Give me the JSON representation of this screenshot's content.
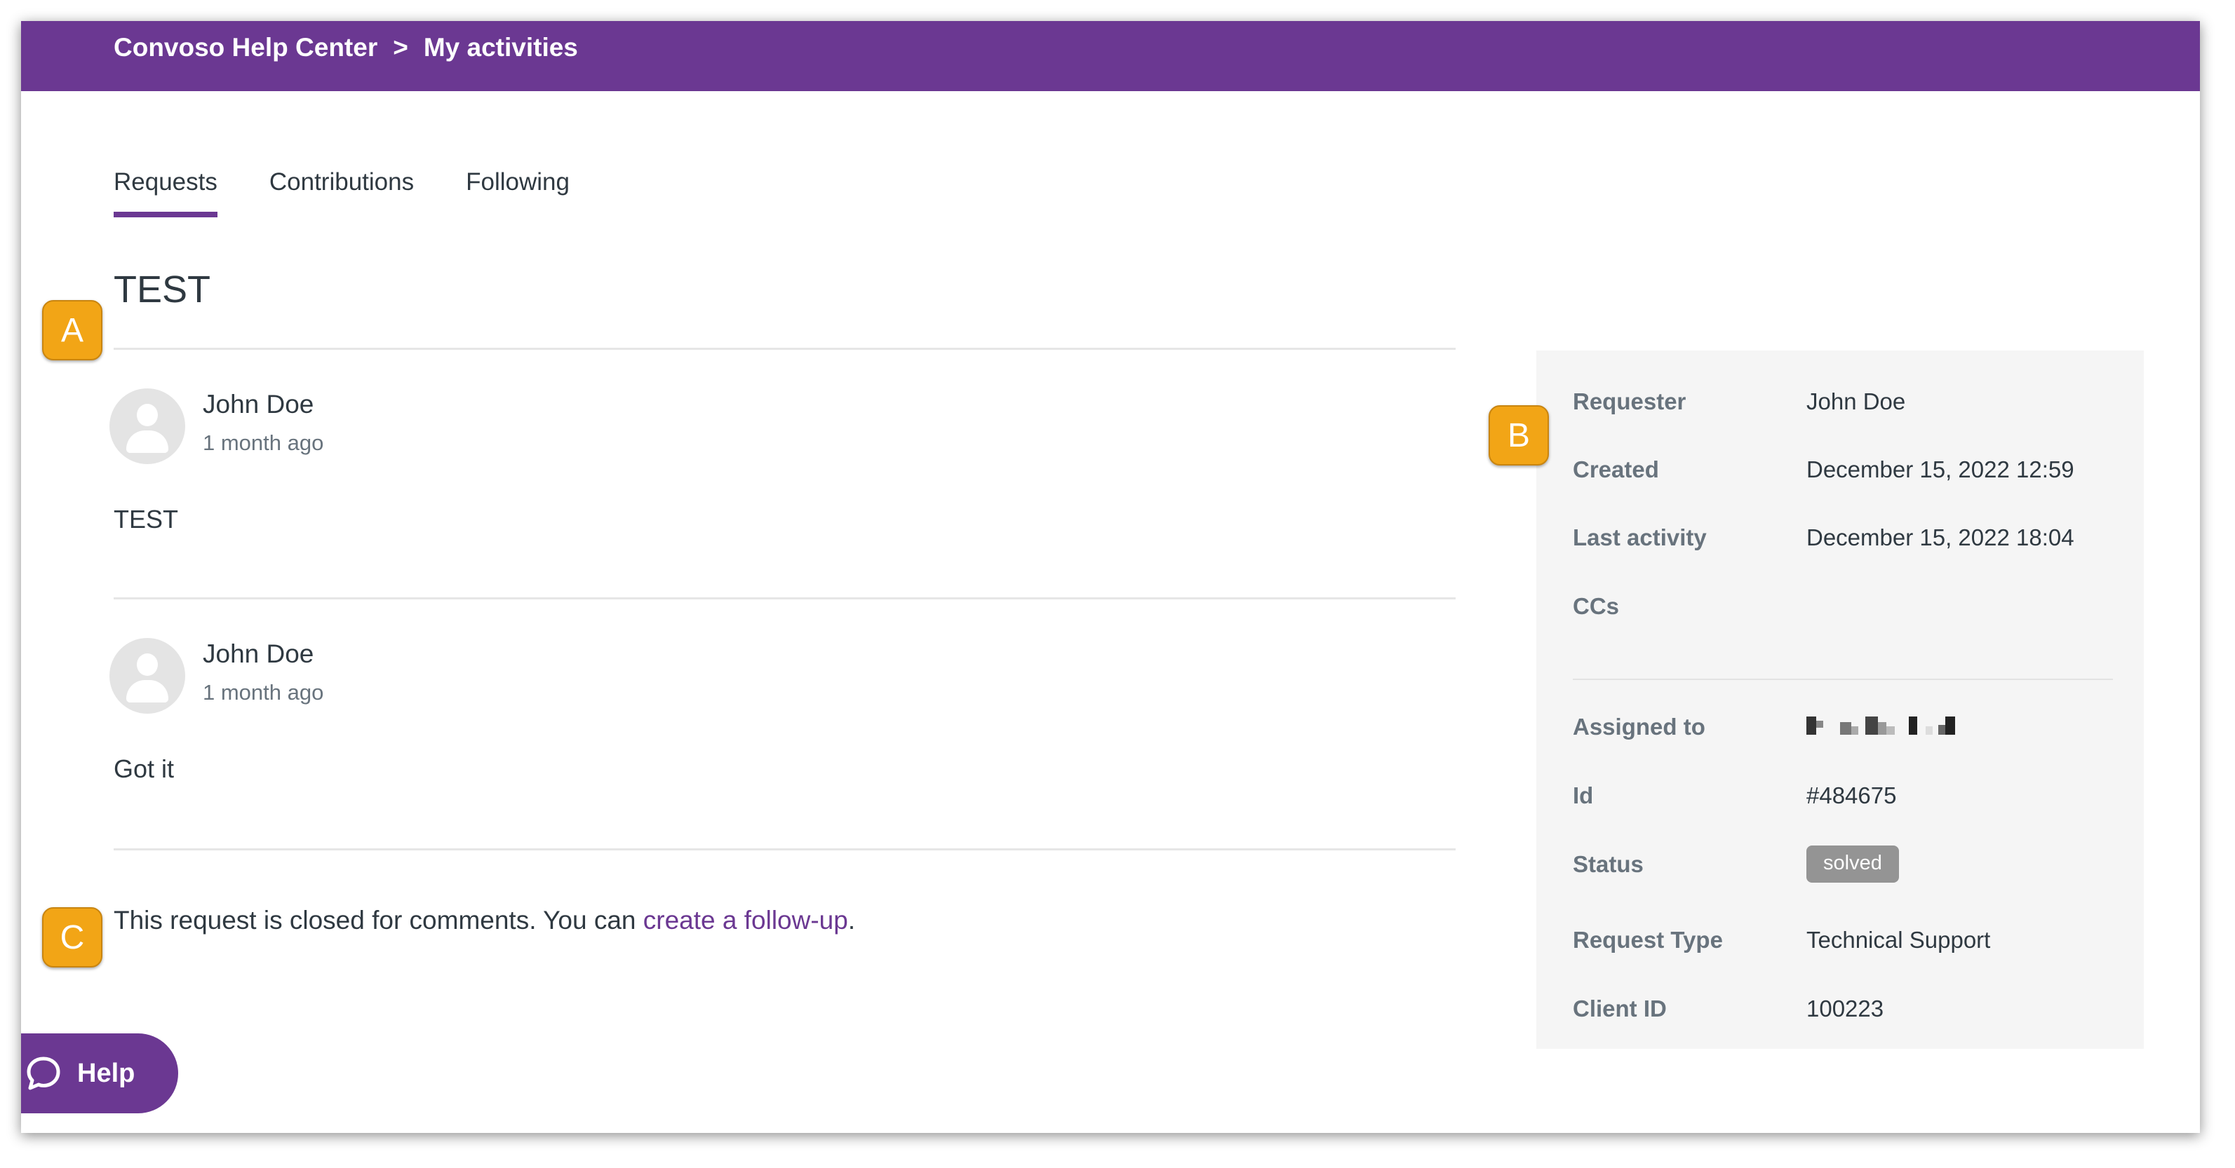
{
  "header": {
    "breadcrumb": [
      "Convoso Help Center",
      "My activities"
    ],
    "separator": ">"
  },
  "tabs": [
    {
      "label": "Requests",
      "active": true
    },
    {
      "label": "Contributions",
      "active": false
    },
    {
      "label": "Following",
      "active": false
    }
  ],
  "request": {
    "title": "TEST",
    "comments": [
      {
        "author": "John Doe",
        "time": "1 month ago",
        "body": "TEST"
      },
      {
        "author": "John Doe",
        "time": "1 month ago",
        "body": "Got it"
      }
    ],
    "closed_note": {
      "text": "This request is closed for comments. You can ",
      "link": "create a follow-up",
      "suffix": "."
    }
  },
  "details": {
    "requester": {
      "label": "Requester",
      "value": "John Doe"
    },
    "created": {
      "label": "Created",
      "value": "December 15, 2022 12:59"
    },
    "last_activity": {
      "label": "Last activity",
      "value": "December 15, 2022 18:04"
    },
    "ccs": {
      "label": "CCs",
      "value": ""
    },
    "assigned_to": {
      "label": "Assigned to"
    },
    "id": {
      "label": "Id",
      "value": "#484675"
    },
    "status": {
      "label": "Status",
      "value": "solved"
    },
    "request_type": {
      "label": "Request Type",
      "value": "Technical Support"
    },
    "client_id": {
      "label": "Client ID",
      "value": "100223"
    }
  },
  "callouts": [
    "A",
    "B",
    "C"
  ],
  "help_button": {
    "label": "Help",
    "icon": "chat-bubble-icon"
  },
  "colors": {
    "brand": "#6b3892",
    "callout": "#f2a516",
    "sidebar_bg": "#f5f5f5",
    "badge": "#949494"
  }
}
